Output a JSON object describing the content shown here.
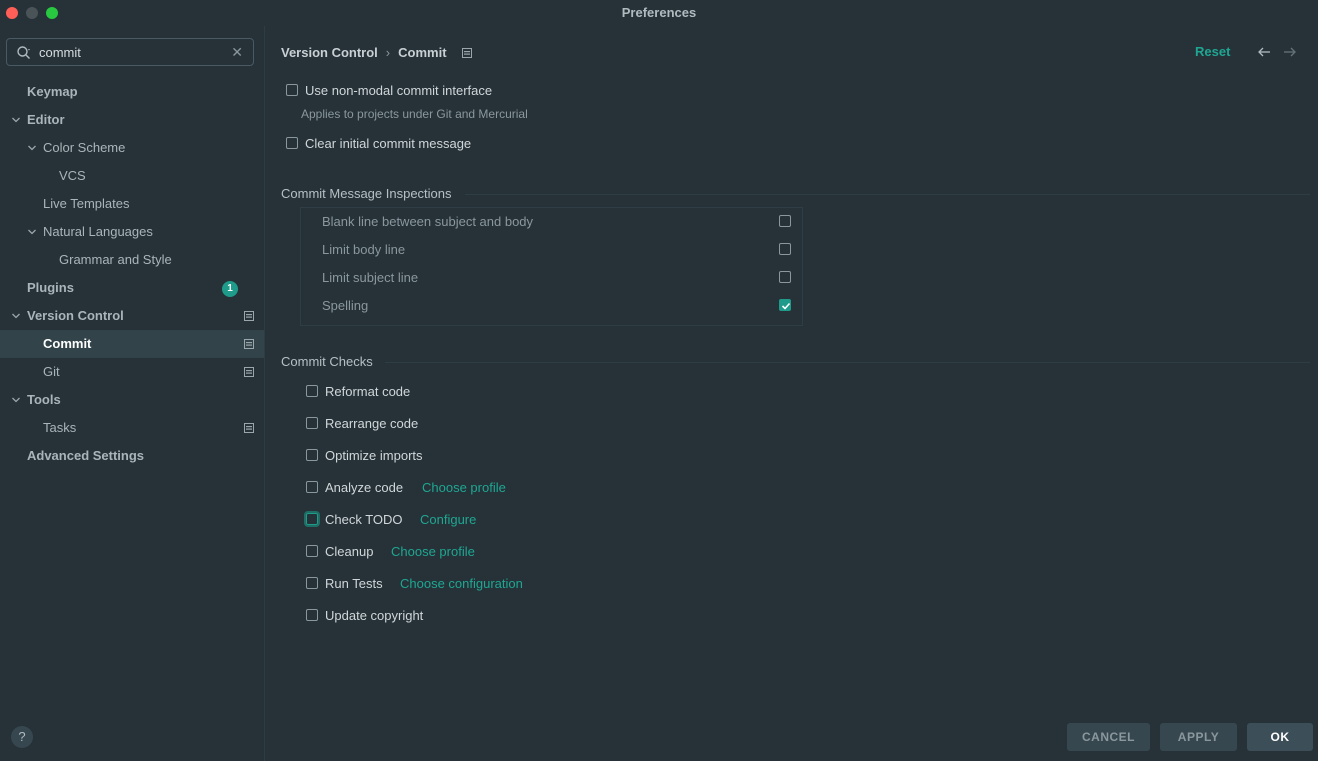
{
  "window": {
    "title": "Preferences"
  },
  "search": {
    "value": "commit",
    "placeholder": ""
  },
  "sidebar": {
    "items": [
      {
        "label": "Keymap",
        "level": 0,
        "bold": true
      },
      {
        "label": "Editor",
        "level": 0,
        "bold": true,
        "expanded": true
      },
      {
        "label": "Color Scheme",
        "level": 1,
        "expanded": true
      },
      {
        "label": "VCS",
        "level": 2
      },
      {
        "label": "Live Templates",
        "level": 1
      },
      {
        "label": "Natural Languages",
        "level": 1,
        "expanded": true
      },
      {
        "label": "Grammar and Style",
        "level": 2
      },
      {
        "label": "Plugins",
        "level": 0,
        "bold": true,
        "badge": "1"
      },
      {
        "label": "Version Control",
        "level": 0,
        "bold": true,
        "expanded": true
      },
      {
        "label": "Commit",
        "level": 1,
        "selected": true
      },
      {
        "label": "Git",
        "level": 1
      },
      {
        "label": "Tools",
        "level": 0,
        "bold": true,
        "expanded": true
      },
      {
        "label": "Tasks",
        "level": 1
      },
      {
        "label": "Advanced Settings",
        "level": 0,
        "bold": true
      }
    ],
    "help_label": "?"
  },
  "breadcrumb": {
    "parent": "Version Control",
    "separator": "›",
    "current": "Commit"
  },
  "header": {
    "reset_label": "Reset"
  },
  "options": {
    "non_modal": {
      "label": "Use non-modal commit interface",
      "checked": false,
      "hint": "Applies to projects under Git and Mercurial"
    },
    "clear_message": {
      "label": "Clear initial commit message",
      "checked": false
    }
  },
  "inspections": {
    "title": "Commit Message Inspections",
    "items": [
      {
        "label": "Blank line between subject and body",
        "checked": false
      },
      {
        "label": "Limit body line",
        "checked": false
      },
      {
        "label": "Limit subject line",
        "checked": false
      },
      {
        "label": "Spelling",
        "checked": true
      }
    ]
  },
  "checks": {
    "title": "Commit Checks",
    "items": [
      {
        "label": "Reformat code",
        "checked": false
      },
      {
        "label": "Rearrange code",
        "checked": false
      },
      {
        "label": "Optimize imports",
        "checked": false
      },
      {
        "label": "Analyze code",
        "checked": false,
        "link": "Choose profile"
      },
      {
        "label": "Check TODO",
        "checked": false,
        "link": "Configure",
        "focused": true
      },
      {
        "label": "Cleanup",
        "checked": false,
        "link": "Choose profile"
      },
      {
        "label": "Run Tests",
        "checked": false,
        "link": "Choose configuration"
      },
      {
        "label": "Update copyright",
        "checked": false
      }
    ]
  },
  "buttons": {
    "cancel": "CANCEL",
    "apply": "APPLY",
    "ok": "OK"
  },
  "colors": {
    "background": "#263238",
    "accent": "#1e9b8a",
    "link": "#1fa693",
    "selection": "#32434a"
  }
}
